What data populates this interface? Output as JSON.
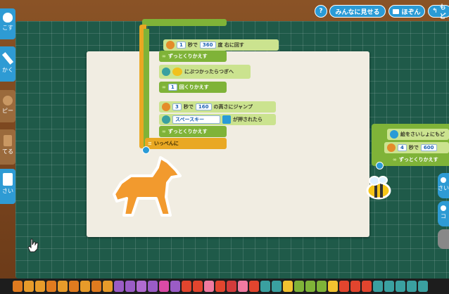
{
  "top": {
    "help_icon": "?",
    "share_label": "みんなに見せる",
    "save_label": "ほぞん",
    "back_icon": "↰",
    "back_label": "もど"
  },
  "left_tools": [
    {
      "label": "こす",
      "icon": "apple-icon"
    },
    {
      "label": "かく",
      "icon": "pencil-icon"
    },
    {
      "label": "ピー",
      "icon": "apple-icon"
    },
    {
      "label": "てる",
      "icon": "trash-icon"
    },
    {
      "label": "さい",
      "icon": "blank-icon"
    }
  ],
  "script1": {
    "rotate": {
      "value1": "1",
      "unit1": "秒で",
      "value2": "360",
      "unit2": "度 右に回す"
    },
    "forever1": "ずっとくりかえす",
    "bump": "にぶつかったらつぎへ",
    "repeat": {
      "value": "1",
      "label": "回くりかえす"
    },
    "jump": {
      "value1": "3",
      "unit1": "秒で",
      "value2": "160",
      "unit2": "の高さにジャンプ"
    },
    "keypress": {
      "key": "スペースキー",
      "label": "が押されたら"
    },
    "forever2": "ずっとくりかえす",
    "together": "いっぺんに"
  },
  "script2": {
    "turn": "絵をさいしょにもど",
    "move": {
      "value1": "4",
      "unit1": "秒で",
      "value2": "600"
    },
    "forever": "ずっとくりかえす"
  },
  "right_tools": [
    {
      "label": "さい"
    },
    {
      "label": "コ"
    }
  ]
}
